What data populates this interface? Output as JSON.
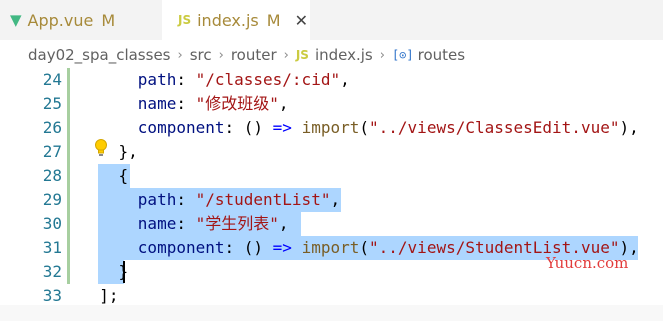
{
  "tabs": [
    {
      "name": "App.vue",
      "status": "M",
      "icon": "vue-icon"
    },
    {
      "name": "index.js",
      "status": "M",
      "icon": "js-icon",
      "close": "✕"
    }
  ],
  "breadcrumb": {
    "items": [
      "day02_spa_classes",
      "src",
      "router",
      "index.js",
      "routes"
    ],
    "js_icon": "JS",
    "symbol_icon": "[⊙]"
  },
  "lines": [
    {
      "num": "24",
      "tokens": [
        {
          "t": "path",
          "c": "k"
        },
        {
          "t": ": ",
          "c": "p"
        },
        {
          "t": "\"/classes/:cid\"",
          "c": "s"
        },
        {
          "t": ",",
          "c": "p"
        }
      ],
      "indent": "      "
    },
    {
      "num": "25",
      "tokens": [
        {
          "t": "name",
          "c": "k"
        },
        {
          "t": ": ",
          "c": "p"
        },
        {
          "t": "\"修改班级\"",
          "c": "s"
        },
        {
          "t": ",",
          "c": "p"
        }
      ],
      "indent": "      "
    },
    {
      "num": "26",
      "tokens": [
        {
          "t": "component",
          "c": "k"
        },
        {
          "t": ": () ",
          "c": "p"
        },
        {
          "t": "=>",
          "c": "kw"
        },
        {
          "t": " ",
          "c": "p"
        },
        {
          "t": "import",
          "c": "f"
        },
        {
          "t": "(",
          "c": "p"
        },
        {
          "t": "\"../views/ClassesEdit.vue\"",
          "c": "s"
        },
        {
          "t": "),",
          "c": "p"
        }
      ],
      "indent": "      "
    },
    {
      "num": "27",
      "tokens": [
        {
          "t": "},",
          "c": "p"
        }
      ],
      "indent": "    "
    },
    {
      "num": "28",
      "tokens": [
        {
          "t": "{",
          "c": "p"
        }
      ],
      "indent": "    "
    },
    {
      "num": "29",
      "tokens": [
        {
          "t": "path",
          "c": "k"
        },
        {
          "t": ": ",
          "c": "p"
        },
        {
          "t": "\"/studentList\"",
          "c": "s"
        },
        {
          "t": ",",
          "c": "p"
        }
      ],
      "indent": "      "
    },
    {
      "num": "30",
      "tokens": [
        {
          "t": "name",
          "c": "k"
        },
        {
          "t": ": ",
          "c": "p"
        },
        {
          "t": "\"学生列表\"",
          "c": "s"
        },
        {
          "t": ",",
          "c": "p"
        }
      ],
      "indent": "      "
    },
    {
      "num": "31",
      "tokens": [
        {
          "t": "component",
          "c": "k"
        },
        {
          "t": ": () ",
          "c": "p"
        },
        {
          "t": "=>",
          "c": "kw"
        },
        {
          "t": " ",
          "c": "p"
        },
        {
          "t": "import",
          "c": "f"
        },
        {
          "t": "(",
          "c": "p"
        },
        {
          "t": "\"../views/StudentList.vue\"",
          "c": "s"
        },
        {
          "t": "),",
          "c": "p"
        }
      ],
      "indent": "      "
    },
    {
      "num": "32",
      "tokens": [
        {
          "t": "}",
          "c": "p"
        }
      ],
      "indent": "    "
    },
    {
      "num": "33",
      "tokens": [
        {
          "t": "];",
          "c": "p"
        }
      ],
      "indent": "  "
    }
  ],
  "watermark": "Yuucn.com",
  "colors": {
    "accent_modified": "#a78a3a",
    "selection": "#add6ff",
    "line_number": "#237893",
    "gutter_modified": "#a7cfa0"
  }
}
